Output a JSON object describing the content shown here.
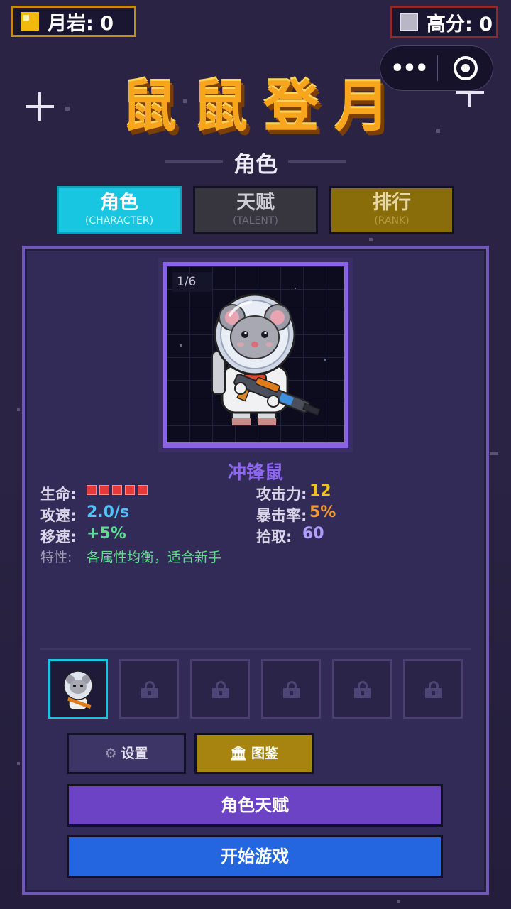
{
  "top_bar": {
    "moon_rock": "月岩: 0",
    "high_score": "高分: 0",
    "mini_menu_dots": "•••"
  },
  "title": "鼠鼠登月",
  "section_title": "角色",
  "tabs": [
    {
      "label": "角色",
      "sub": "(CHARACTER)"
    },
    {
      "label": "天赋",
      "sub": "(TALENT)"
    },
    {
      "label": "排行",
      "sub": "(RANK)"
    }
  ],
  "character": {
    "page_indicator": "1/6",
    "name": "冲锋鼠",
    "hp_label": "生命:",
    "hp_pips": 5,
    "attack_speed_label": "攻速:",
    "attack_speed": "2.0/s",
    "move_speed_label": "移速:",
    "move_speed": "+5%",
    "attack_label": "攻击力:",
    "attack": "12",
    "crit_label": "暴击率:",
    "crit": "5%",
    "pickup_label": "拾取:",
    "pickup": "60",
    "trait_label": "特性:",
    "trait": "各属性均衡，适合新手"
  },
  "buttons": {
    "settings": "设置",
    "codex": "图鉴",
    "talent": "角色天赋",
    "start": "开始游戏"
  },
  "colors": {
    "accent_cyan": "#19c6e2",
    "title_orange": "#f7a51c",
    "name_purple": "#8d66ee",
    "attack_yellow": "#f2c11a",
    "crit_orange": "#f39a33",
    "speed_blue": "#4fc3f7",
    "move_green": "#5fdc8e",
    "pickup_purple": "#b39cff"
  }
}
